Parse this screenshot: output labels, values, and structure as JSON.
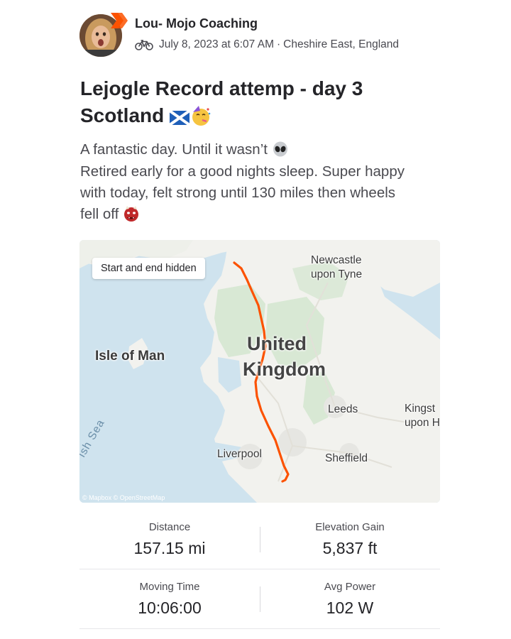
{
  "activity": {
    "athlete_name": "Lou- Mojo Coaching",
    "date_time": "July 8, 2023 at 6:07 AM",
    "location": "Cheshire East, England",
    "separator": "·",
    "activity_type_icon": "bike-icon",
    "title_line1": "Lejogle Record attemp - day 3",
    "title_line2": "Scotland",
    "title_emojis": [
      "scotland-flag-icon",
      "partying-face-icon"
    ],
    "description": [
      "A fantastic day. Until it wasn’t",
      "Retired early for a good nights sleep. Super happy",
      "with today, felt strong until 130 miles then wheels",
      "fell off"
    ],
    "description_emojis": [
      "alien-icon",
      "ogre-icon"
    ]
  },
  "map": {
    "privacy_pill": "Start and end hidden",
    "labels": {
      "newcastle": "Newcastle\nupon Tyne",
      "newcastle_l1": "Newcastle",
      "newcastle_l2": "upon Tyne",
      "united": "United",
      "kingdom": "Kingdom",
      "isle_of_man": "Isle of Man",
      "leeds": "Leeds",
      "kingston_l1": "Kingst",
      "kingston_l2": "upon H",
      "liverpool": "Liverpool",
      "sheffield": "Sheffield",
      "sea": "ish Sea"
    },
    "attribution": "© Mapbox © OpenStreetMap",
    "route_color": "#fc5200",
    "land_color": "#f2f2ee",
    "water_color": "#cfe3ee",
    "park_color": "#d8e8d4"
  },
  "stats": [
    {
      "label": "Distance",
      "value": "157.15 mi"
    },
    {
      "label": "Elevation Gain",
      "value": "5,837 ft"
    },
    {
      "label": "Moving Time",
      "value": "10:06:00"
    },
    {
      "label": "Avg Power",
      "value": "102 W"
    }
  ]
}
